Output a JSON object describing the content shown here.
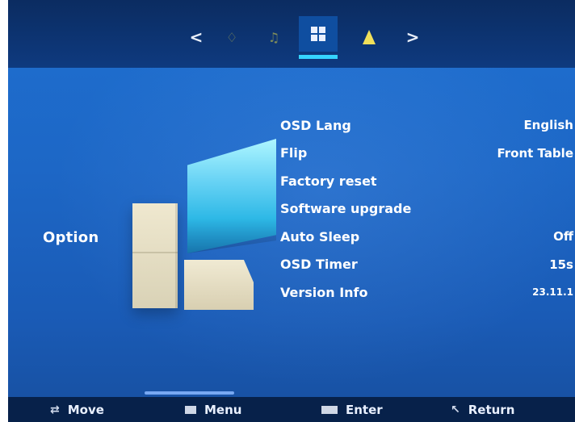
{
  "top_nav": {
    "prev_arrow": "<",
    "next_arrow": ">",
    "icons": [
      {
        "name": "picture-icon",
        "glyph": "♢"
      },
      {
        "name": "audio-icon",
        "glyph": "♫"
      },
      {
        "name": "option-icon",
        "glyph": ""
      },
      {
        "name": "setup-icon",
        "glyph": ""
      }
    ],
    "active_index": 2,
    "colors": {
      "active_underline": "#35d4ff",
      "triangle_icon": "#f1e05a"
    }
  },
  "section": {
    "label": "Option"
  },
  "menu": {
    "items": [
      {
        "label": "OSD Lang",
        "value": "English"
      },
      {
        "label": "Flip",
        "value": "Front Table"
      },
      {
        "label": "Factory reset",
        "value": ""
      },
      {
        "label": "Software upgrade",
        "value": ""
      },
      {
        "label": "Auto Sleep",
        "value": "Off"
      },
      {
        "label": "OSD Timer",
        "value": "15s"
      },
      {
        "label": "Version Info",
        "value": "23.11.1"
      }
    ]
  },
  "bottom_hints": [
    {
      "icon": "move-icon",
      "label": "Move"
    },
    {
      "icon": "menu-key-icon",
      "label": "Menu"
    },
    {
      "icon": "ok-key-icon",
      "label": "Enter"
    },
    {
      "icon": "return-icon",
      "label": "Return"
    }
  ]
}
